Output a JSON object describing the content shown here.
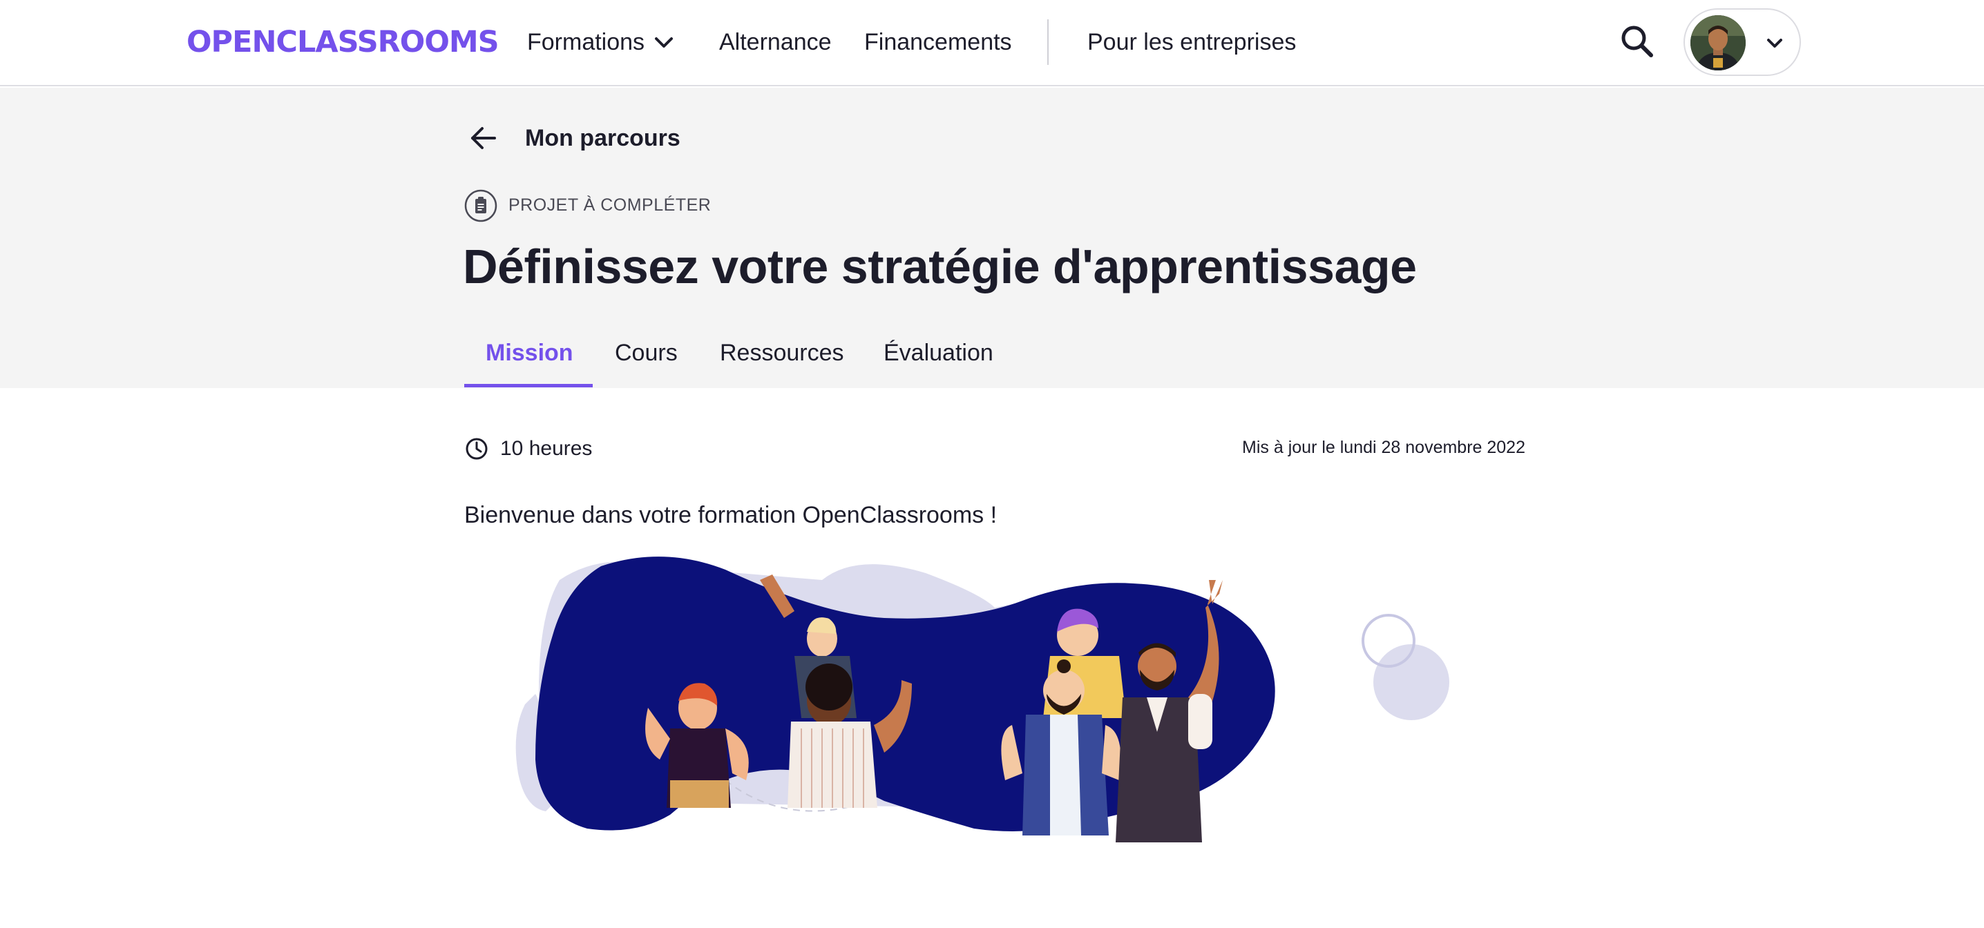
{
  "nav": {
    "logo": "OPENCLASSROOMS",
    "formations": "Formations",
    "alternance": "Alternance",
    "financements": "Financements",
    "entreprises": "Pour les entreprises",
    "icons": {
      "formations_chevron": "chevron-down-icon",
      "search": "search-icon",
      "account_chevron": "chevron-down-icon",
      "avatar": "avatar"
    }
  },
  "header": {
    "back_label": "Mon parcours",
    "back_icon": "arrow-left-icon",
    "type_icon": "clipboard-icon",
    "type_label": "PROJET À COMPLÉTER",
    "title": "Définissez votre stratégie d'apprentissage",
    "tabs": [
      {
        "label": "Mission",
        "active": true
      },
      {
        "label": "Cours",
        "active": false
      },
      {
        "label": "Ressources",
        "active": false
      },
      {
        "label": "Évaluation",
        "active": false
      }
    ]
  },
  "content": {
    "clock_icon": "clock-icon",
    "duration": "10 heures",
    "updated": "Mis à jour le lundi 28 novembre 2022",
    "welcome": "Bienvenue dans votre formation OpenClassrooms !",
    "illustration": "group-of-people-waving-illustration"
  },
  "colors": {
    "accent": "#7451eb",
    "header_bg": "#f4f4f4",
    "text": "#1d1d2b",
    "illustration_navy": "#0c117a",
    "illustration_lavender": "#dcdcee"
  }
}
